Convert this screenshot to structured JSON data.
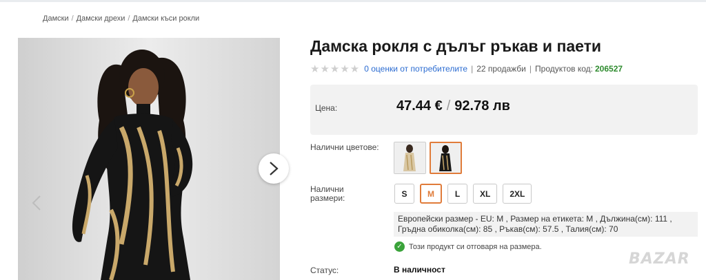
{
  "breadcrumb": {
    "items": [
      "Дамски",
      "Дамски дрехи",
      "Дамски къси рокли"
    ]
  },
  "gallery": {
    "prev_icon": "chevron-left-icon",
    "next_icon": "chevron-right-icon"
  },
  "product": {
    "title": "Дамска рокля с дълъг ръкав и паети",
    "stars_empty": "★★★★★",
    "rating_link": "0 оценки от потребителите",
    "sales": "22 продажби",
    "code_label": "Продуктов код:",
    "code_value": "206527"
  },
  "price": {
    "label": "Цена:",
    "eur": "47.44 €",
    "separator": "/",
    "bgn": "92.78 лв"
  },
  "colors": {
    "label": "Налични цветове:",
    "options": [
      "gold-sequin",
      "black-gold-sequin"
    ],
    "selected_index": 1
  },
  "sizes": {
    "label": "Налични размери:",
    "options": [
      "S",
      "M",
      "L",
      "XL",
      "2XL"
    ],
    "selected": "M"
  },
  "size_info": {
    "line1": "Европейски размер - EU: M ,  Размер на етикета: M ,  Дължина(см): 111 ,",
    "line2": "Гръдна обиколка(см): 85 ,  Ръкав(см): 57.5 ,  Талия(см): 70"
  },
  "fit_note": "Този продукт си отговаря на размера.",
  "status": {
    "label": "Статус:",
    "value": "В наличност"
  },
  "logo": "BAZAR",
  "accent_color": "#e07b39",
  "link_color": "#2a6bd1",
  "code_color": "#2e8b2e"
}
